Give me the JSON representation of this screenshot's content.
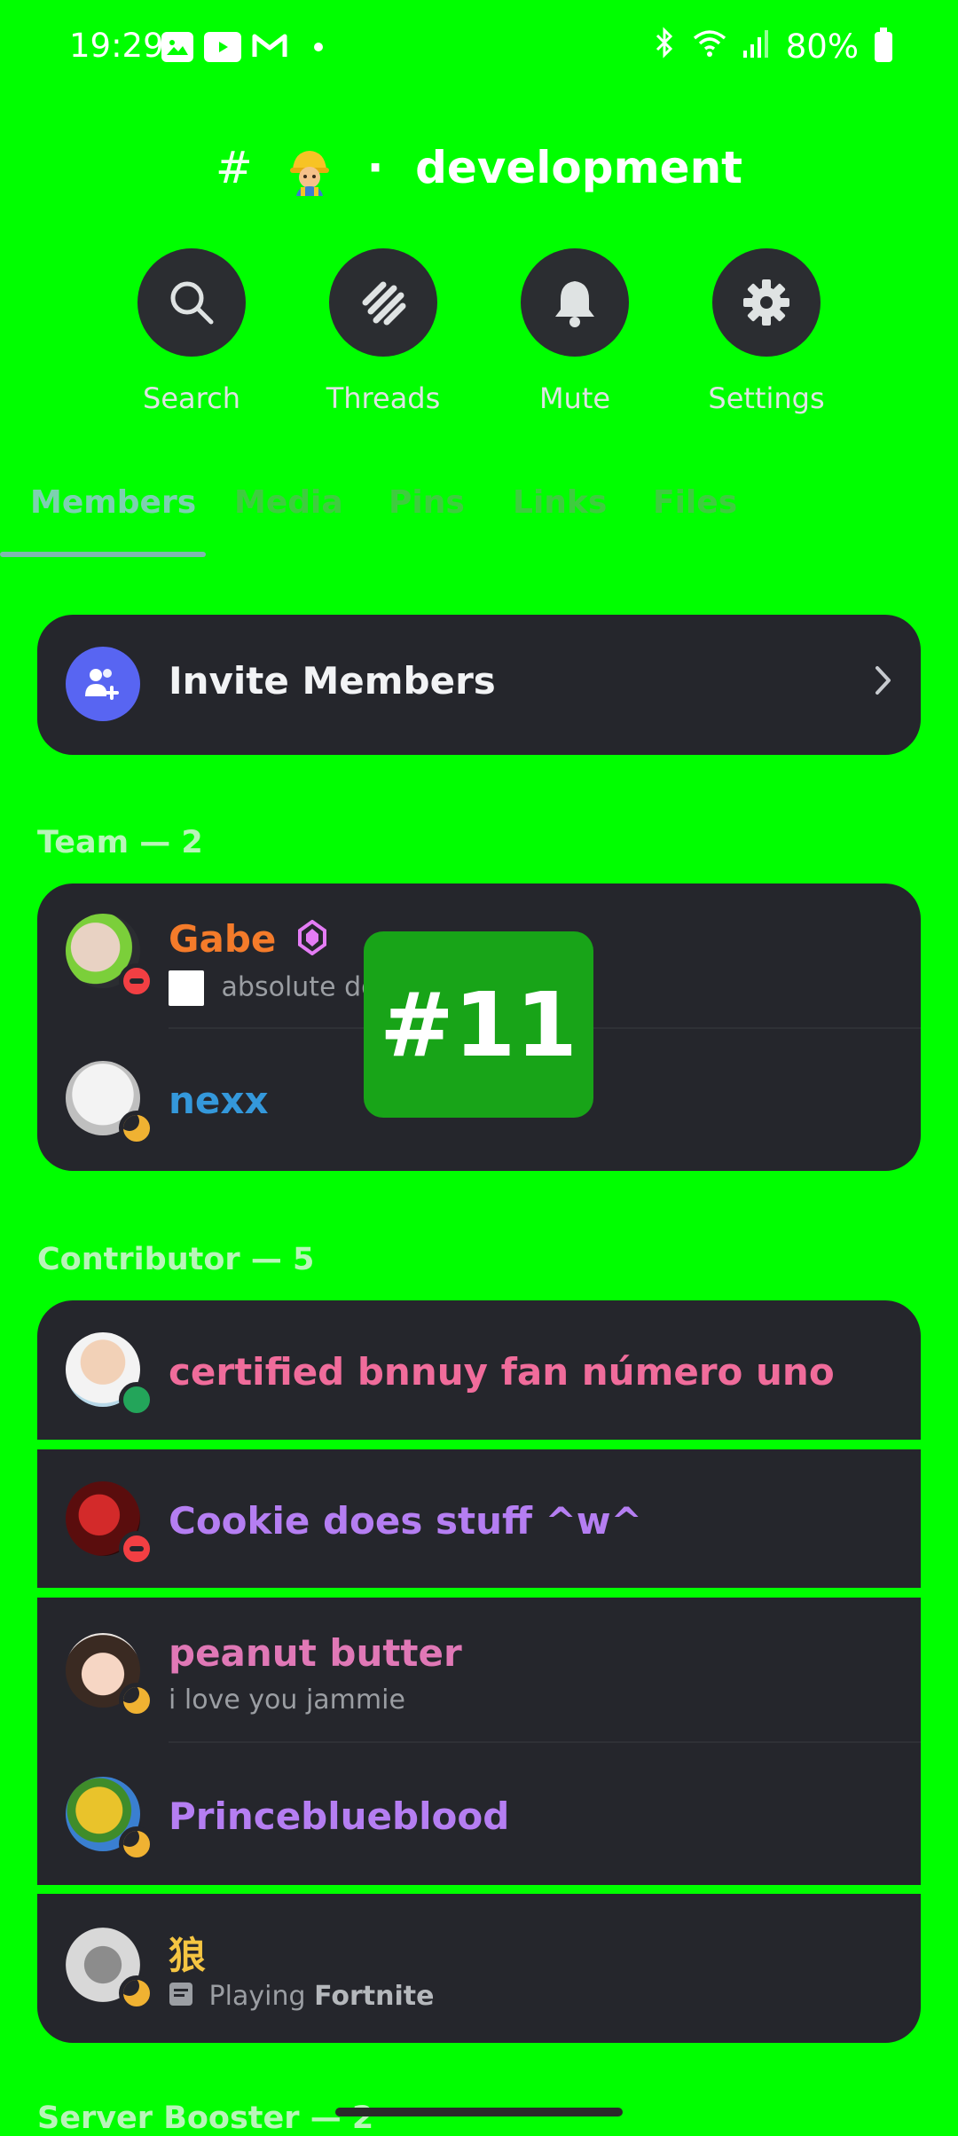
{
  "status_bar": {
    "time": "19:29",
    "battery": "80%",
    "left_icons": [
      "gallery-icon",
      "youtube-icon",
      "gmail-icon"
    ],
    "right_icons": [
      "bluetooth-icon",
      "wifi-icon",
      "signal-icon",
      "battery-icon"
    ]
  },
  "channel": {
    "hash": "#",
    "separator": "·",
    "name": "development",
    "emoji_icon": "construction-worker-icon"
  },
  "actions": [
    {
      "label": "Search",
      "icon": "search-icon"
    },
    {
      "label": "Threads",
      "icon": "threads-icon"
    },
    {
      "label": "Mute",
      "icon": "bell-icon"
    },
    {
      "label": "Settings",
      "icon": "gear-icon"
    }
  ],
  "tabs": [
    {
      "label": "Members",
      "active": true
    },
    {
      "label": "Media",
      "active": false
    },
    {
      "label": "Pins",
      "active": false
    },
    {
      "label": "Links",
      "active": false
    },
    {
      "label": "Files",
      "active": false
    }
  ],
  "invite": {
    "label": "Invite Members",
    "icon": "add-user-icon"
  },
  "sections": [
    {
      "header": "Team — 2"
    },
    {
      "header": "Contributor — 5"
    },
    {
      "header": "Server Booster — 2"
    }
  ],
  "members": {
    "gabe": {
      "name": "Gabe",
      "status_text": "absolute dogshit week",
      "color": "#f47b2a",
      "presence": "dnd",
      "badge": "boost-gem-icon"
    },
    "nexx": {
      "name": "nexx",
      "color": "#3498db",
      "presence": "idle"
    },
    "certified": {
      "name": "certified bnnuy fan número uno",
      "color": "#f06c9b",
      "presence": "online"
    },
    "cookie": {
      "name": "Cookie does stuff ^w^",
      "color": "#b57ef2",
      "presence": "dnd"
    },
    "peanut": {
      "name": "peanut butter",
      "status_text": "i love you jammie",
      "color": "#e078b6",
      "presence": "idle"
    },
    "prince": {
      "name": "Princeblueblood",
      "color": "#b57ef2",
      "presence": "idle"
    },
    "wolf": {
      "name": "狼",
      "activity_prefix": "Playing",
      "activity_name": "Fortnite",
      "color": "#f5c542",
      "presence": "idle"
    }
  },
  "overlay_label": "#11"
}
